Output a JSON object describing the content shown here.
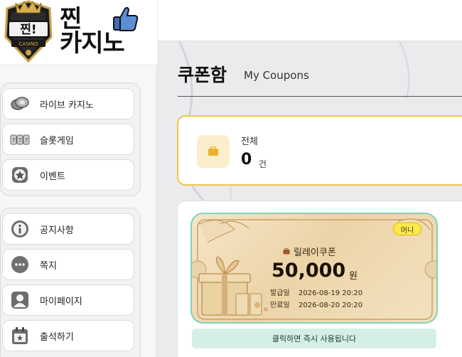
{
  "logo": {
    "badge_top": "찐!",
    "badge_bottom": "CASINO",
    "line1": "찐",
    "line2": "카지노"
  },
  "sidebar": {
    "group1": [
      {
        "label": "라이브 카지노",
        "icon": "chips-icon"
      },
      {
        "label": "슬롯게임",
        "icon": "slot-reels-icon"
      },
      {
        "label": "이벤트",
        "icon": "star-badge-icon"
      }
    ],
    "group2": [
      {
        "label": "공지사항",
        "icon": "info-icon"
      },
      {
        "label": "쪽지",
        "icon": "chat-bubble-icon"
      },
      {
        "label": "마이페이지",
        "icon": "user-icon"
      },
      {
        "label": "출석하기",
        "icon": "calendar-icon"
      }
    ]
  },
  "page": {
    "title": "쿠폰함",
    "subtitle": "My Coupons"
  },
  "summary": {
    "label": "전체",
    "count": "0",
    "unit": "건",
    "icon": "briefcase-icon"
  },
  "coupon": {
    "badge": "머니",
    "type": "릴레이쿠폰",
    "amount": "50,000",
    "currency": "원",
    "issued_label": "발급일",
    "issued_value": "2026-08-19 20:20",
    "expires_label": "만료일",
    "expires_value": "2026-08-20 20:20",
    "cta": "클릭하면 즉시 사용됩니다"
  },
  "colors": {
    "accent_yellow": "#f0c64a",
    "coupon_border": "#7fd3b6",
    "cta_bg": "#d5efe5",
    "badge_bg": "#ffe94a"
  }
}
